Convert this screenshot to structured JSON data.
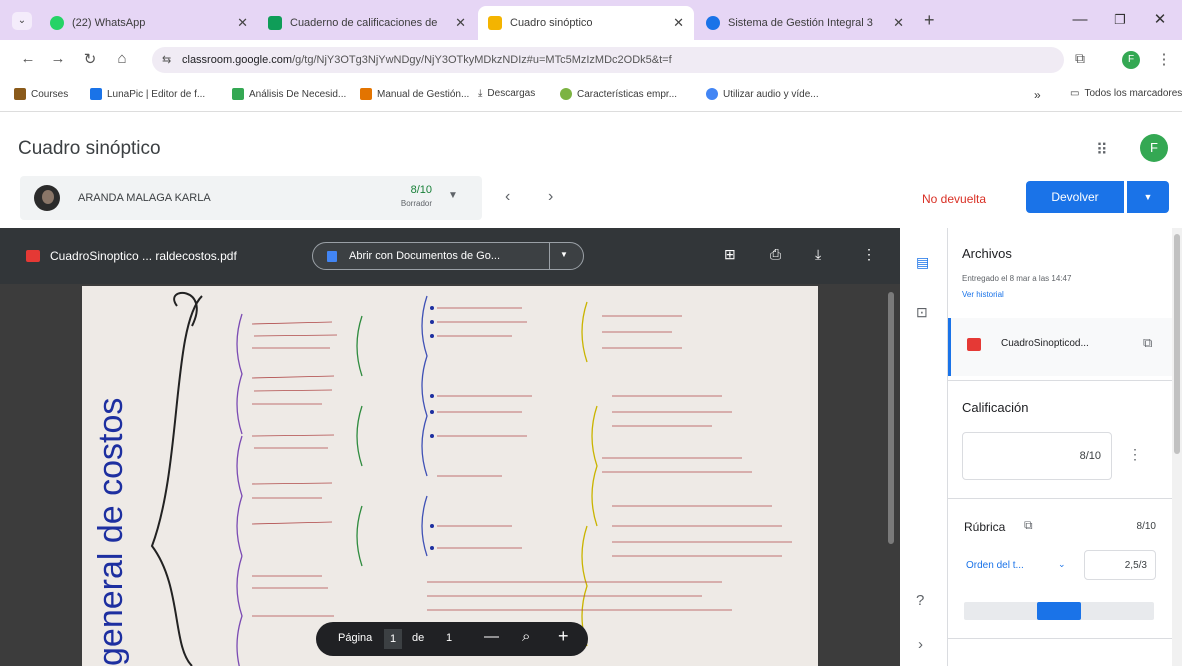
{
  "browser": {
    "tabs": [
      {
        "title": "(22) WhatsApp",
        "color": "#25d366"
      },
      {
        "title": "Cuaderno de calificaciones de",
        "color": "#0f9d58"
      },
      {
        "title": "Cuadro sinóptico",
        "color": "#f4b400"
      },
      {
        "title": "Sistema de Gestión Integral 3",
        "color": "#1a73e8"
      }
    ],
    "new_tab": "+",
    "url_prefix": "classroom.google.com",
    "url_rest": "/g/tg/NjY3OTg3NjYwNDgy/NjY3OTkyMDkzNDIz#u=MTc5MzIzMDc2ODk5&t=f",
    "profile_letter": "F",
    "bookmarks": [
      {
        "label": "Courses",
        "color": "#8a5a1a"
      },
      {
        "label": "LunaPic | Editor de f...",
        "color": "#1a73e8"
      },
      {
        "label": "Análisis De Necesid...",
        "color": "#34a853"
      },
      {
        "label": "Manual de Gestión...",
        "color": "#e37400"
      },
      {
        "label": "Descargas",
        "color": "#5f6368"
      },
      {
        "label": "Características empr...",
        "color": "#7cb342"
      },
      {
        "label": "Utilizar audio y víde...",
        "color": "#4285f4"
      }
    ],
    "bookmarks_overflow": "»",
    "all_bookmarks": "Todos los marcadores"
  },
  "header": {
    "title": "Cuadro sinóptico",
    "avatar_letter": "F"
  },
  "student": {
    "name": "ARANDA MALAGA KARLA",
    "grade": "8/10",
    "grade_status": "Borrador"
  },
  "actions": {
    "not_returned": "No devuelta",
    "return_label": "Devolver"
  },
  "pdf": {
    "filename": "CuadroSinoptico ... raldecostos.pdf",
    "open_with": "Abrir con Documentos de Go...",
    "page_label": "Página",
    "page_current": "1",
    "page_of": "de",
    "page_total": "1",
    "handwriting_title": "general de costos"
  },
  "panel": {
    "files_heading": "Archivos",
    "submitted": "Entregado el 8 mar a las 14:47",
    "history_link": "Ver historial",
    "file_name": "CuadroSinopticod...",
    "grade_heading": "Calificación",
    "grade_value": "8/10",
    "rubric_heading": "Rúbrica",
    "rubric_total": "8/10",
    "criterion_name": "Orden del t...",
    "criterion_score": "2,5/3",
    "criterion_level": 0.5
  },
  "colors": {
    "accent": "#1a73e8",
    "danger": "#d93025",
    "tab_strip": "#e6d6f5",
    "green_avatar": "#34a853"
  }
}
